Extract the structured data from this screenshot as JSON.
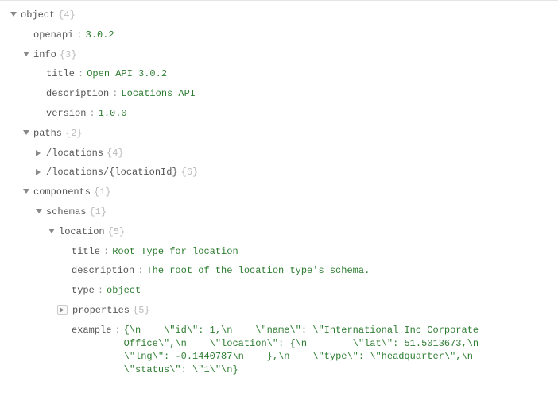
{
  "root": {
    "label": "object",
    "count": "{4}"
  },
  "openapi": {
    "key": "openapi",
    "value": "3.0.2"
  },
  "info": {
    "key": "info",
    "count": "{3}",
    "title": {
      "key": "title",
      "value": "Open API 3.0.2"
    },
    "description": {
      "key": "description",
      "value": "Locations API"
    },
    "version": {
      "key": "version",
      "value": "1.0.0"
    }
  },
  "paths": {
    "key": "paths",
    "count": "{2}",
    "p0": {
      "key": "/locations",
      "count": "{4}"
    },
    "p1": {
      "key": "/locations/{locationId}",
      "count": "{6}"
    }
  },
  "components": {
    "key": "components",
    "count": "{1}",
    "schemas": {
      "key": "schemas",
      "count": "{1}",
      "location": {
        "key": "location",
        "count": "{5}",
        "title": {
          "key": "title",
          "value": "Root Type for location"
        },
        "description": {
          "key": "description",
          "value": "The root of the location type's schema."
        },
        "type": {
          "key": "type",
          "value": "object"
        },
        "properties": {
          "key": "properties",
          "count": "{5}"
        },
        "example": {
          "key": "example",
          "value": "{\\n    \\\"id\\\": 1,\\n    \\\"name\\\": \\\"International Inc Corporate Office\\\",\\n    \\\"location\\\": {\\n        \\\"lat\\\": 51.5013673,\\n        \\\"lng\\\": -0.1440787\\n    },\\n    \\\"type\\\": \\\"headquarter\\\",\\n    \\\"status\\\": \\\"1\\\"\\n}"
        }
      }
    }
  }
}
